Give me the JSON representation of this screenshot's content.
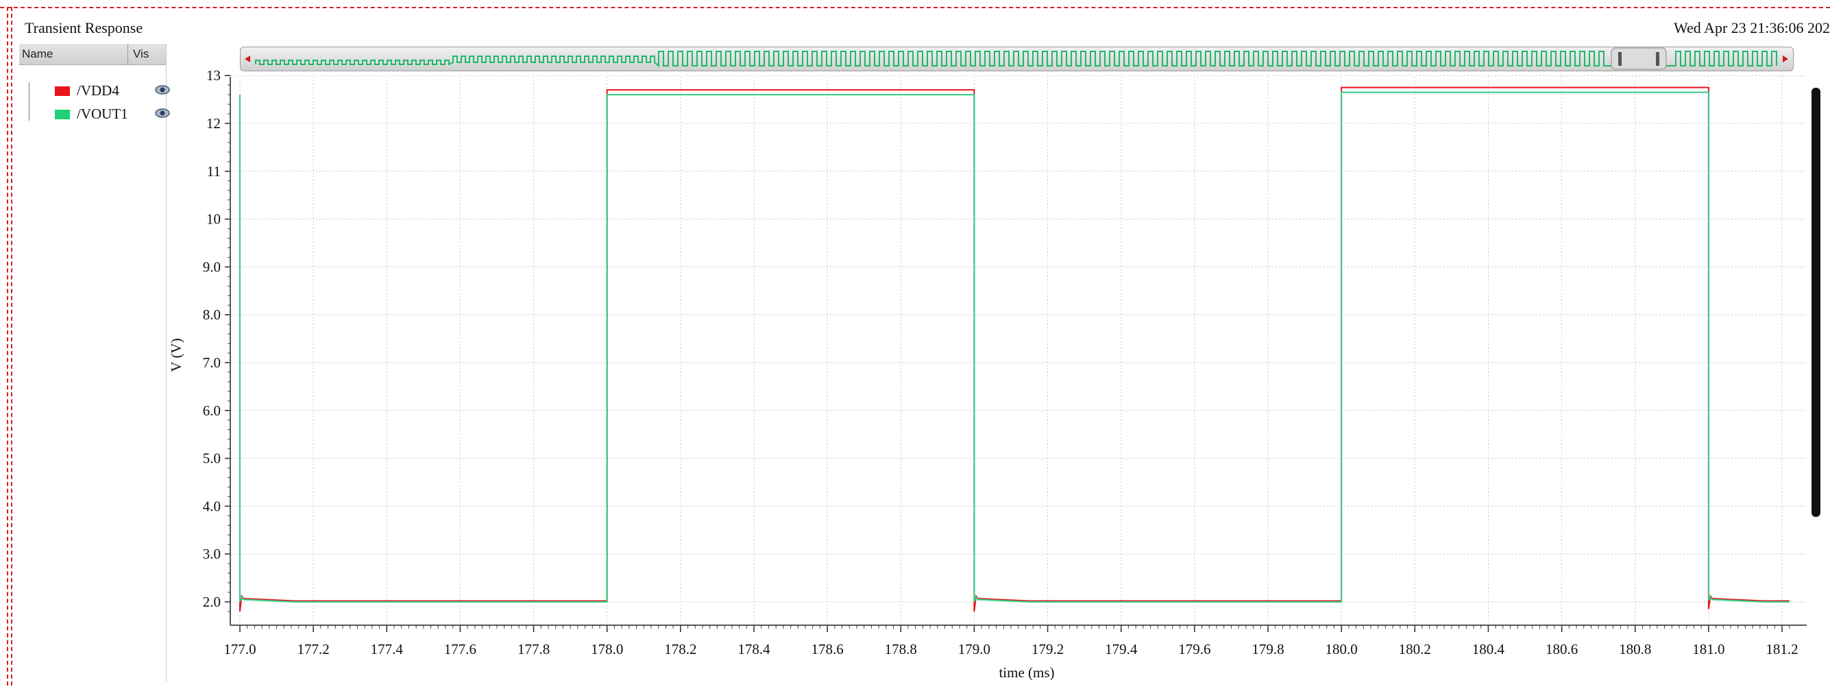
{
  "window": {
    "title": "Transient Response",
    "timestamp": "Wed Apr 23 21:36:06 202"
  },
  "legend": {
    "header_name": "Name",
    "header_vis": "Vis",
    "items": [
      {
        "label": "/VDD4",
        "color": "#e8151b"
      },
      {
        "label": "/VOUT1",
        "color": "#1fd07a"
      }
    ]
  },
  "colors": {
    "vdd4": "#e8151b",
    "vout1": "#2ecf86",
    "frame": "#d61f1f",
    "grid": "#c8c8c8"
  },
  "chart_data": {
    "type": "line",
    "xlabel": "time (ms)",
    "ylabel": "V (V)",
    "xlim": [
      177.0,
      181.22
    ],
    "ylim": [
      1.65,
      13.0
    ],
    "grid": true,
    "legend_placement": "left panel",
    "x_ticks": [
      "177.0",
      "177.2",
      "177.4",
      "177.6",
      "177.8",
      "178.0",
      "178.2",
      "178.4",
      "178.6",
      "178.8",
      "179.0",
      "179.2",
      "179.4",
      "179.6",
      "179.8",
      "180.0",
      "180.2",
      "180.4",
      "180.6",
      "180.8",
      "181.0",
      "181.2"
    ],
    "y_ticks": [
      "2.0",
      "3.0",
      "4.0",
      "5.0",
      "6.0",
      "7.0",
      "8.0",
      "9.0",
      "10",
      "11",
      "12",
      "13"
    ],
    "series": [
      {
        "name": "/VDD4",
        "color": "#e8151b",
        "x": [
          177.0,
          177.0,
          177.005,
          177.01,
          177.15,
          178.0,
          178.0,
          179.0,
          179.0,
          179.0,
          179.005,
          179.01,
          179.15,
          180.0,
          180.0,
          181.0,
          181.0,
          181.005,
          181.01,
          181.15,
          181.22
        ],
        "y": [
          12.6,
          1.8,
          2.12,
          2.07,
          2.02,
          2.02,
          12.7,
          12.7,
          6.15,
          1.8,
          2.12,
          2.07,
          2.02,
          2.02,
          12.75,
          12.75,
          1.85,
          2.12,
          2.07,
          2.02,
          2.02
        ]
      },
      {
        "name": "/VOUT1",
        "color": "#2ecf86",
        "x": [
          177.0,
          177.0,
          177.005,
          177.01,
          177.15,
          178.0,
          178.0,
          179.0,
          179.0,
          179.005,
          179.01,
          179.15,
          180.0,
          180.0,
          181.0,
          181.0,
          181.005,
          181.01,
          181.15,
          181.22
        ],
        "y": [
          12.6,
          2.0,
          2.1,
          2.05,
          2.0,
          2.0,
          12.6,
          12.6,
          2.0,
          2.1,
          2.05,
          2.0,
          2.0,
          12.65,
          12.65,
          2.05,
          2.1,
          2.05,
          2.0,
          2.0
        ]
      }
    ]
  }
}
